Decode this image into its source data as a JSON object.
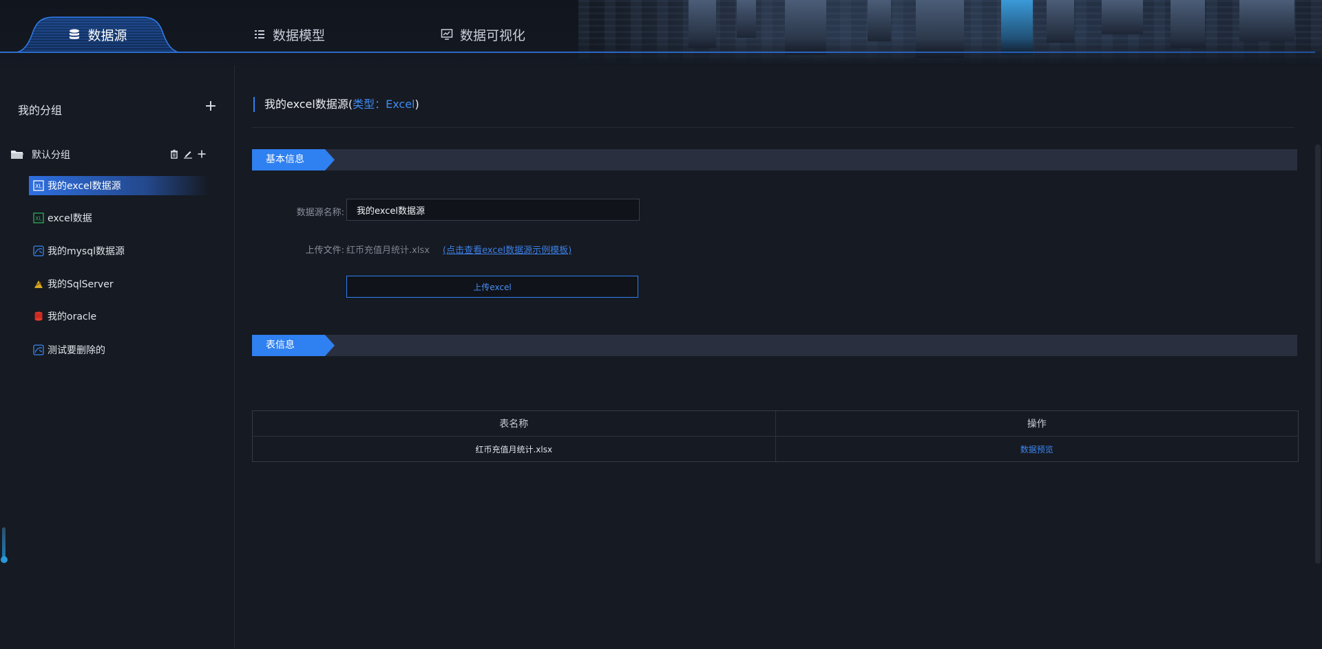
{
  "nav": {
    "tabs": [
      {
        "label": "数据源",
        "icon": "database-icon",
        "active": true
      },
      {
        "label": "数据模型",
        "icon": "list-icon"
      },
      {
        "label": "数据可视化",
        "icon": "chart-monitor-icon"
      }
    ],
    "accent": "#2f80f0"
  },
  "sidebar": {
    "title": "我的分组",
    "add_icon": "+",
    "group": {
      "label": "默认分组",
      "actions": [
        "trash-icon",
        "edit-icon",
        "plus-icon"
      ]
    },
    "items": [
      {
        "label": "我的excel数据源",
        "icon": "excel-icon",
        "active": true
      },
      {
        "label": "excel数据",
        "icon": "excel-icon"
      },
      {
        "label": "我的mysql数据源",
        "icon": "mysql-icon"
      },
      {
        "label": "我的SqlServer",
        "icon": "sqlserver-icon"
      },
      {
        "label": "我的oracle",
        "icon": "oracle-icon"
      },
      {
        "label": "测试要删除的",
        "icon": "mysql-icon"
      }
    ]
  },
  "main": {
    "heading": {
      "name": "我的excel数据源",
      "paren_open": "(",
      "type_text": "类型：Excel",
      "paren_close": ")"
    },
    "sections": {
      "basic": "基本信息",
      "table": "表信息"
    },
    "form": {
      "name_label": "数据源名称:",
      "name_value": "我的excel数据源",
      "upload_label": "上传文件:",
      "upload_file": "红币充值月统计.xlsx",
      "template_link": "(点击查看excel数据源示例模板)",
      "upload_button": "上传excel"
    },
    "table": {
      "columns": [
        "表名称",
        "操作"
      ],
      "rows": [
        {
          "name": "红币充值月统计.xlsx",
          "action": "数据预览"
        }
      ]
    }
  }
}
